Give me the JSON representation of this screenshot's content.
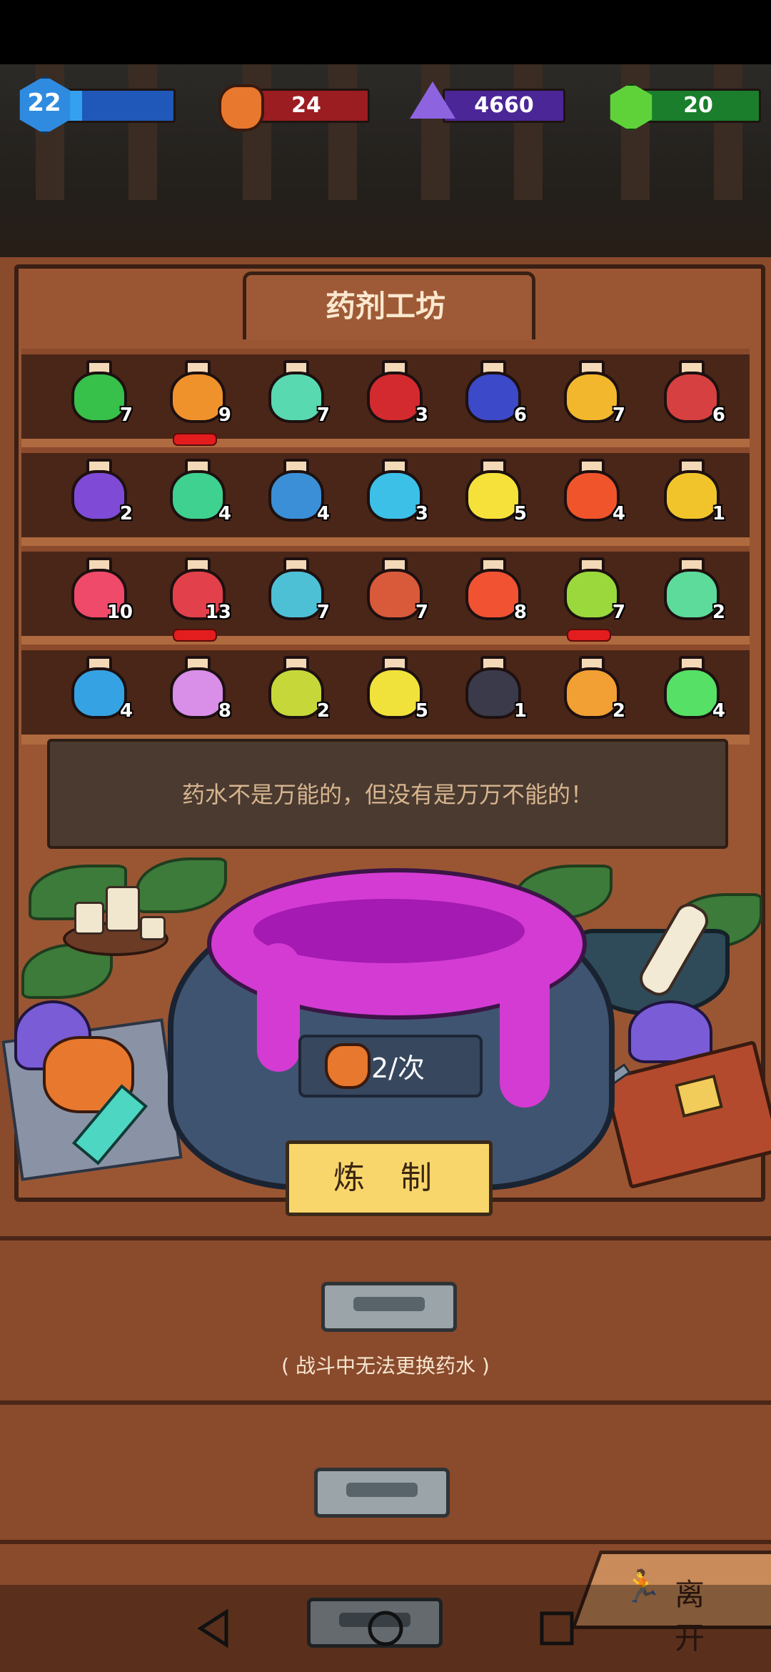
{
  "hud": {
    "level": "22",
    "level_progress": 0.2,
    "ore": "24",
    "purple_crystal": "4660",
    "green_gem": "20",
    "colors": {
      "level_bar": "#1f58b9",
      "ore_bar": "#9b1c21",
      "crystal_bar": "#4a2696",
      "gem_bar": "#1a7e2c"
    }
  },
  "workshop": {
    "title": "药剂工坊",
    "quote": "药水不是万能的，但没有是万万不能的！",
    "brew_cost": "2/次",
    "brew_label": "炼 制",
    "note": "( 战斗中无法更换药水 )",
    "leave_label": "离 开"
  },
  "shelves": [
    [
      {
        "count": "7",
        "color": "#37c04a"
      },
      {
        "count": "9",
        "color": "#f0922c"
      },
      {
        "count": "7",
        "color": "#59d9b0"
      },
      {
        "count": "3",
        "color": "#d32a2f"
      },
      {
        "count": "6",
        "color": "#3c49c8"
      },
      {
        "count": "7",
        "color": "#f2b72d"
      },
      {
        "count": "6",
        "color": "#d74040"
      }
    ],
    [
      {
        "count": "2",
        "color": "#7f4ad6"
      },
      {
        "count": "4",
        "color": "#3ed190"
      },
      {
        "count": "4",
        "color": "#3b8fd6"
      },
      {
        "count": "3",
        "color": "#3cc0e8"
      },
      {
        "count": "5",
        "color": "#f5e13a"
      },
      {
        "count": "4",
        "color": "#f0542b"
      },
      {
        "count": "1",
        "color": "#f2c42b"
      }
    ],
    [
      {
        "count": "10",
        "color": "#ef4a6a"
      },
      {
        "count": "13",
        "color": "#e2404a"
      },
      {
        "count": "7",
        "color": "#4ec0d6"
      },
      {
        "count": "7",
        "color": "#d85a3a"
      },
      {
        "count": "8",
        "color": "#f05232"
      },
      {
        "count": "7",
        "color": "#9ad83c"
      },
      {
        "count": "2",
        "color": "#5ddb9a"
      }
    ],
    [
      {
        "count": "4",
        "color": "#35a2e4"
      },
      {
        "count": "8",
        "color": "#d98ee8"
      },
      {
        "count": "2",
        "color": "#c6d839"
      },
      {
        "count": "5",
        "color": "#f0e23a"
      },
      {
        "count": "1",
        "color": "#3a3a4a"
      },
      {
        "count": "2",
        "color": "#f2a033"
      },
      {
        "count": "4",
        "color": "#56e066"
      }
    ]
  ],
  "nav": {
    "back": "back-icon",
    "home": "home-icon",
    "recents": "recents-icon"
  }
}
